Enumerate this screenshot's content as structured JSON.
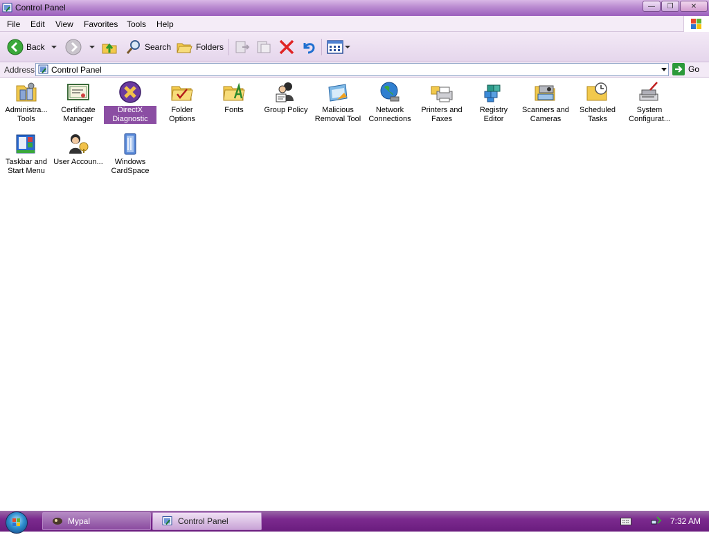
{
  "window": {
    "title": "Control Panel"
  },
  "menu": [
    "File",
    "Edit",
    "View",
    "Favorites",
    "Tools",
    "Help"
  ],
  "toolbar": {
    "back_label": "Back",
    "search_label": "Search",
    "folders_label": "Folders"
  },
  "address": {
    "label": "Address",
    "value": "Control Panel",
    "go_label": "Go"
  },
  "items": [
    {
      "label": "Administra... Tools",
      "icon": "admin-tools-icon"
    },
    {
      "label": "Certificate Manager",
      "icon": "certificate-icon"
    },
    {
      "label": "DirectX Diagnostic",
      "icon": "directx-icon",
      "selected": true
    },
    {
      "label": "Folder Options",
      "icon": "folder-options-icon"
    },
    {
      "label": "Fonts",
      "icon": "fonts-icon"
    },
    {
      "label": "Group Policy",
      "icon": "group-policy-icon"
    },
    {
      "label": "Malicious Removal Tool",
      "icon": "malicious-removal-icon"
    },
    {
      "label": "Network Connections",
      "icon": "network-icon"
    },
    {
      "label": "Printers and Faxes",
      "icon": "printer-icon"
    },
    {
      "label": "Registry Editor",
      "icon": "registry-icon"
    },
    {
      "label": "Scanners and Cameras",
      "icon": "scanner-icon"
    },
    {
      "label": "Scheduled Tasks",
      "icon": "scheduled-tasks-icon"
    },
    {
      "label": "System Configurat...",
      "icon": "system-config-icon"
    },
    {
      "label": "Taskbar and Start Menu",
      "icon": "taskbar-icon"
    },
    {
      "label": "User Accoun...",
      "icon": "user-accounts-icon"
    },
    {
      "label": "Windows CardSpace",
      "icon": "cardspace-icon"
    }
  ],
  "taskbar": {
    "tasks": [
      {
        "label": "Mypal"
      },
      {
        "label": "Control Panel"
      }
    ],
    "clock": "7:32 AM"
  },
  "colors": {
    "accent": "#8b4ea3",
    "taskbar": "#6a1c7e"
  }
}
